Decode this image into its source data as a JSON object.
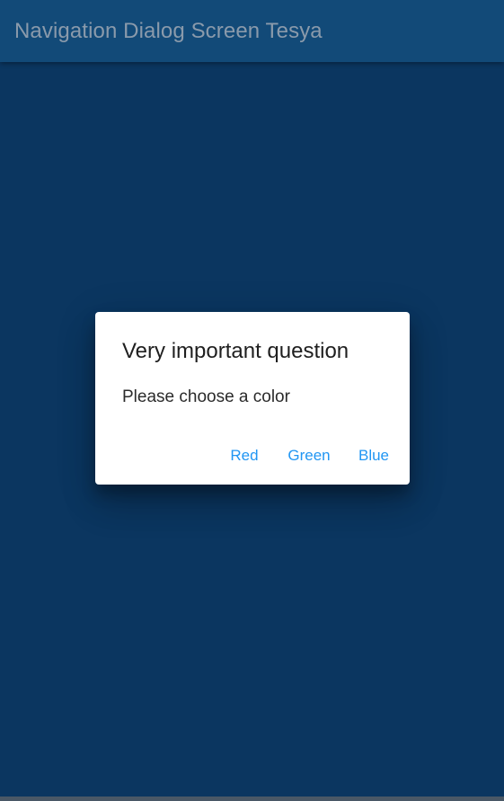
{
  "app_bar": {
    "title": "Navigation Dialog Screen Tesya"
  },
  "dialog": {
    "title": "Very important question",
    "message": "Please choose a color",
    "actions": [
      {
        "label": "Red"
      },
      {
        "label": "Green"
      },
      {
        "label": "Blue"
      }
    ]
  },
  "colors": {
    "app_bar": "#124a78",
    "background": "#0b3660",
    "dialog": "#ffffff",
    "accent": "#2196f3"
  }
}
